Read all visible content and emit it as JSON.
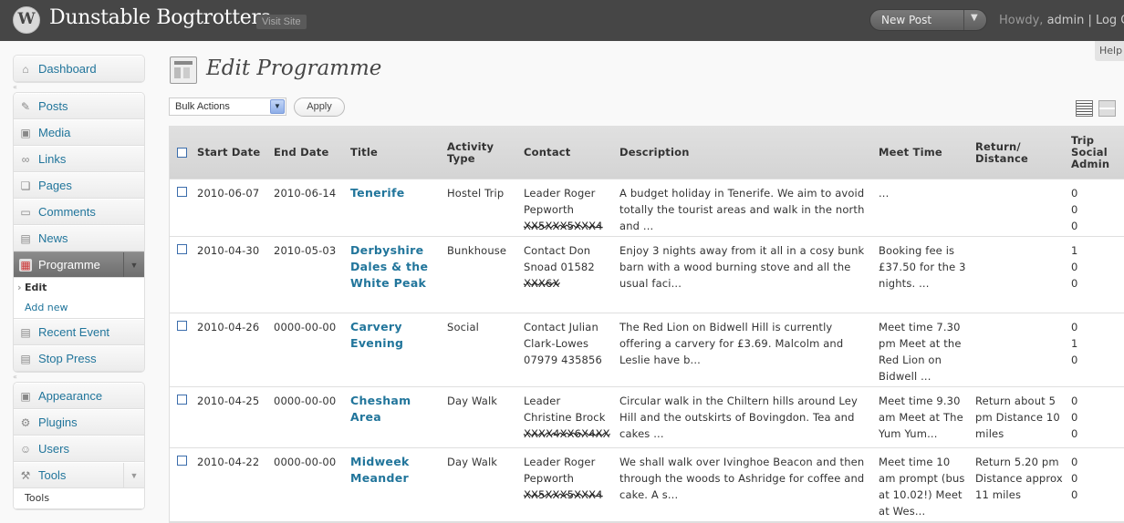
{
  "header": {
    "site_title": "Dunstable Bogtrotters",
    "visit_site": "Visit Site",
    "new_post": "New Post",
    "howdy_prefix": "Howdy, ",
    "user": "admin",
    "logout": " | Log O",
    "help": "Help"
  },
  "sidebar": {
    "items": [
      {
        "label": "Dashboard",
        "icon": "dashboard-icon"
      },
      {
        "label": "Posts",
        "icon": "pin-icon"
      },
      {
        "label": "Media",
        "icon": "media-icon"
      },
      {
        "label": "Links",
        "icon": "link-icon"
      },
      {
        "label": "Pages",
        "icon": "pages-icon"
      },
      {
        "label": "Comments",
        "icon": "comments-icon"
      },
      {
        "label": "News",
        "icon": "news-icon"
      },
      {
        "label": "Programme",
        "icon": "programme-icon"
      },
      {
        "label": "Recent Event",
        "icon": "recent-event-icon"
      },
      {
        "label": "Stop Press",
        "icon": "stop-press-icon"
      },
      {
        "label": "Appearance",
        "icon": "appearance-icon"
      },
      {
        "label": "Plugins",
        "icon": "plugins-icon"
      },
      {
        "label": "Users",
        "icon": "users-icon"
      },
      {
        "label": "Tools",
        "icon": "tools-icon"
      }
    ],
    "programme_submenu": [
      "Edit",
      "Add new"
    ],
    "tools_submenu_partial": "Tools"
  },
  "main": {
    "title": "Edit Programme",
    "bulk_actions": "Bulk Actions",
    "apply": "Apply",
    "columns": [
      "Start Date",
      "End Date",
      "Title",
      "Activity Type",
      "Contact",
      "Description",
      "Meet Time",
      "Return/ Distance",
      "Trip Social Admin"
    ],
    "rows": [
      {
        "start": "2010-06-07",
        "end": "2010-06-14",
        "title": "Tenerife",
        "type": "Hostel Trip",
        "contact": "Leader Roger Pepworth",
        "contact_redacted": "XX5XXX5XXX4",
        "description": "A budget holiday in Tenerife.  We aim to avoid totally the tourist areas and walk in the north and ...",
        "meet": "...",
        "return": "",
        "flags": [
          "0",
          "0",
          "0"
        ]
      },
      {
        "start": "2010-04-30",
        "end": "2010-05-03",
        "title": "Derbyshire Dales & the White Peak",
        "type": "Bunkhouse",
        "contact": "Contact Don Snoad 01582",
        "contact_redacted": "XXX6X",
        "description": "Enjoy 3 nights away from it all in a cosy bunk barn with a wood burning stove and all the usual faci...",
        "meet": "Booking fee is £37.50 for the 3 nights. ...",
        "return": "",
        "flags": [
          "1",
          "0",
          "0"
        ]
      },
      {
        "start": "2010-04-26",
        "end": "0000-00-00",
        "title": "Carvery Evening",
        "type": "Social",
        "contact": "Contact Julian Clark-Lowes 07979 435856",
        "contact_redacted": "",
        "description": "The Red Lion on Bidwell Hill is currently offering a carvery for £3.69.  Malcolm and Leslie have b...",
        "meet": "Meet time 7.30 pm Meet at the Red Lion on Bidwell ...",
        "return": "",
        "flags": [
          "0",
          "1",
          "0"
        ]
      },
      {
        "start": "2010-04-25",
        "end": "0000-00-00",
        "title": "Chesham Area",
        "type": "Day Walk",
        "contact": "Leader Christine Brock",
        "contact_redacted": "XXXX4XX6X4XX",
        "description": "Circular walk in the Chiltern hills around Ley Hill and the outskirts of Bovingdon.  Tea and cakes ...",
        "meet": "Meet time 9.30 am Meet at The Yum Yum...",
        "return": "Return about 5 pm Distance 10 miles",
        "flags": [
          "0",
          "0",
          "0"
        ]
      },
      {
        "start": "2010-04-22",
        "end": "0000-00-00",
        "title": "Midweek Meander",
        "type": "Day Walk",
        "contact": "Leader Roger Pepworth",
        "contact_redacted": "XX5XXX5XXX4",
        "description": "We shall walk over Ivinghoe Beacon and then through the woods to Ashridge for coffee and cake.  A s...",
        "meet": "Meet time 10 am prompt (bus at 10.02!) Meet at Wes...",
        "return": "Return 5.20 pm Distance approx 11 miles",
        "flags": [
          "0",
          "0",
          "0"
        ]
      }
    ]
  }
}
